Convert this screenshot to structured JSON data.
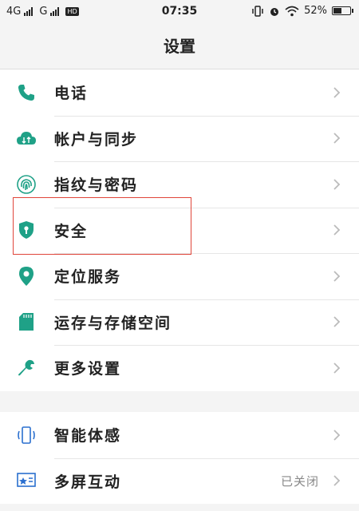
{
  "status": {
    "network1": "4G",
    "network2": "G",
    "hd_badge": "HD",
    "time": "07:35",
    "battery_percent": "52%",
    "battery_level": 0.52
  },
  "header": {
    "title": "设置"
  },
  "colors": {
    "accent": "#1fa187",
    "highlight": "#e0453a"
  },
  "group1": [
    {
      "label": "电话",
      "icon": "phone-icon"
    },
    {
      "label": "帐户与同步",
      "icon": "cloud-sync-icon"
    },
    {
      "label": "指纹与密码",
      "icon": "fingerprint-icon"
    },
    {
      "label": "安全",
      "icon": "shield-icon"
    },
    {
      "label": "定位服务",
      "icon": "location-pin-icon"
    },
    {
      "label": "运存与存储空间",
      "icon": "sd-card-icon"
    },
    {
      "label": "更多设置",
      "icon": "wrench-icon"
    }
  ],
  "group2": [
    {
      "label": "智能体感",
      "icon": "phone-gesture-icon"
    },
    {
      "label": "多屏互动",
      "icon": "screen-cast-icon",
      "value": "已关闭"
    }
  ]
}
